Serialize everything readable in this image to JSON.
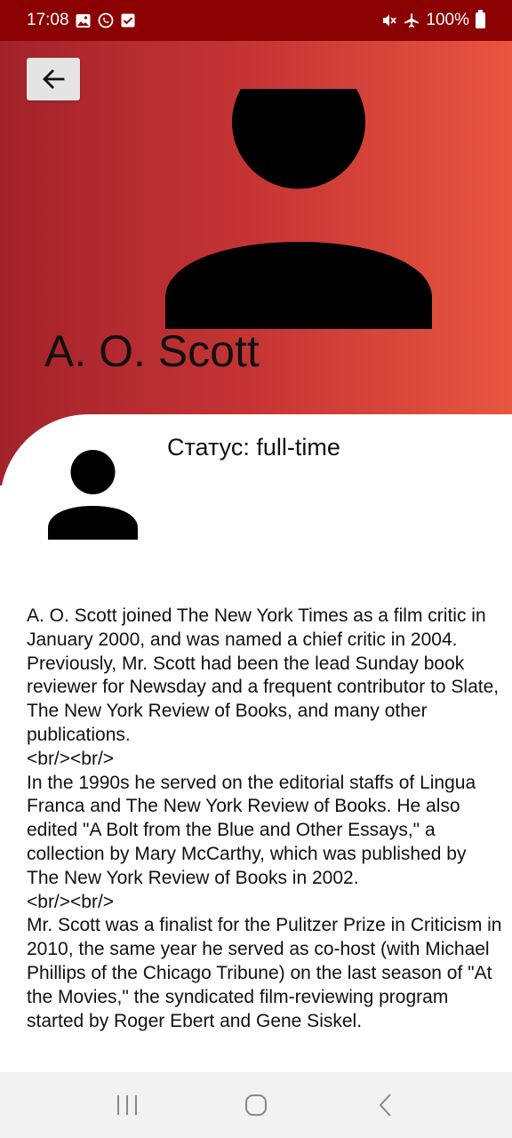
{
  "status_bar": {
    "time": "17:08",
    "battery": "100%",
    "left_icons": [
      "gallery-icon",
      "whatsapp-icon",
      "checkbox-icon"
    ],
    "right_icons": [
      "mute-icon",
      "airplane-icon",
      "battery-icon"
    ]
  },
  "header": {
    "back_icon": "arrow-left-icon",
    "name": "A. O. Scott",
    "gradient": [
      "#a3222a",
      "#e85540"
    ]
  },
  "profile": {
    "status": "Статус: full-time",
    "bio": [
      "A. O. Scott joined The New York Times as a film critic in January 2000, and was named a chief critic in 2004. Previously, Mr. Scott had been the lead Sunday book reviewer for Newsday and a frequent contributor to Slate, The New York Review of Books, and many other publications.",
      "<br/><br/>",
      "In the 1990s he served on the editorial staffs of Lingua Franca and The New York Review of Books. He also edited \"A Bolt from the Blue and Other Essays,\" a collection by Mary McCarthy, which was published by The New York Review of Books in 2002.",
      "<br/><br/>",
      "Mr. Scott was a finalist for the Pulitzer Prize in Criticism in 2010, the same year he served as co-host (with Michael Phillips of the Chicago Tribune) on the last season of \"At the Movies,\" the syndicated film-reviewing program started by Roger Ebert and Gene Siskel."
    ]
  },
  "nav": {
    "recents_icon": "recents-icon",
    "home_icon": "home-icon",
    "back_icon": "back-icon"
  }
}
